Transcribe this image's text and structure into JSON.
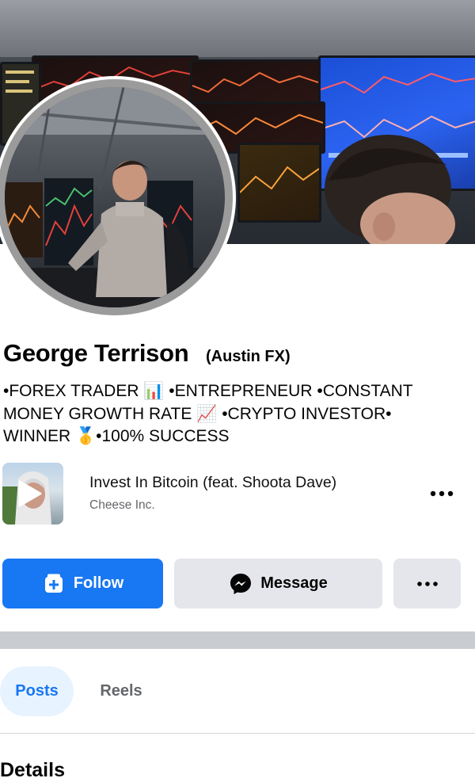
{
  "profile": {
    "name": "George Terrison",
    "alias": "(Austin FX)",
    "bio_lines": [
      "•FOREX TRADER 📊 •ENTREPRENEUR •CONSTANT",
      "MONEY GROWTH RATE 📈 •CRYPTO INVESTOR•",
      "WINNER 🥇•100% SUCCESS"
    ]
  },
  "music": {
    "title": "Invest In Bitcoin (feat. Shoota Dave)",
    "artist": "Cheese Inc."
  },
  "actions": {
    "follow_label": "Follow",
    "message_label": "Message"
  },
  "tabs": [
    {
      "label": "Posts",
      "active": true
    },
    {
      "label": "Reels",
      "active": false
    }
  ],
  "section_heading": "Details",
  "colors": {
    "accent": "#1877f2",
    "accent_tint": "#e7f3ff",
    "button_gray": "#e4e6eb",
    "secondary_text": "#65676b"
  },
  "icons": {
    "follow": "add-friend-icon",
    "message": "messenger-icon",
    "more": "more-horizontal-icon",
    "play": "play-icon"
  }
}
